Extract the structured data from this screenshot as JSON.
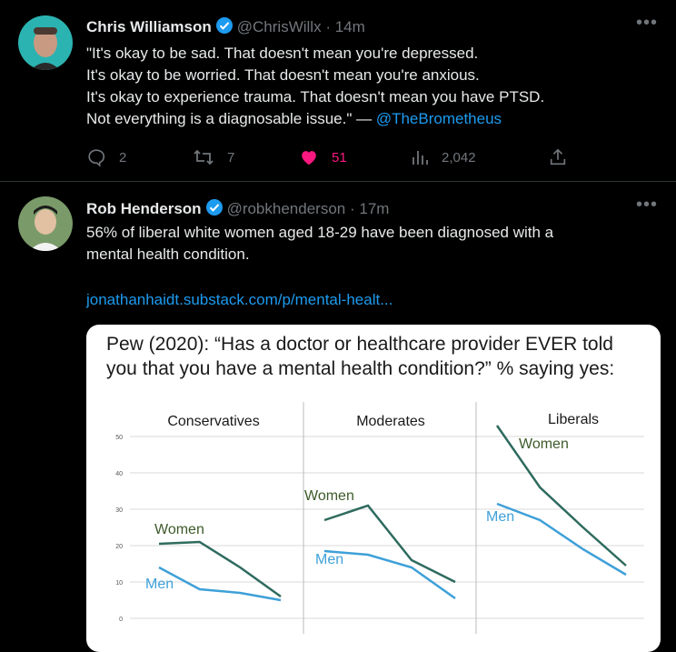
{
  "tweets": [
    {
      "name": "Chris Williamson",
      "handle": "@ChrisWillx",
      "separator": "·",
      "time": "14m",
      "lines": [
        "\"It's okay to be sad. That doesn't mean you're depressed.",
        "It's okay to be worried. That doesn't mean you're anxious.",
        "It's okay to experience trauma. That doesn't mean you have PTSD."
      ],
      "last_line_text": "Not everything is a diagnosable issue.\" — ",
      "mention": "@TheBrometheus",
      "actions": {
        "replies": "2",
        "retweets": "7",
        "likes": "51",
        "views": "2,042"
      }
    },
    {
      "name": "Rob Henderson",
      "handle": "@robkhenderson",
      "separator": "·",
      "time": "17m",
      "lines": [
        "56% of liberal white women aged 18-29 have been diagnosed with a",
        "mental health condition."
      ],
      "link": "jonathanhaidt.substack.com/p/mental-healt...",
      "card": {
        "title_lines": [
          "Pew (2020): “Has a doctor or healthcare provider EVER told",
          "you that you have a mental health condition?” % saying yes:"
        ]
      }
    }
  ],
  "chart_data": {
    "type": "line",
    "title": "Pew (2020): “Has a doctor or healthcare provider EVER told you that you have a mental health condition?” % saying yes:",
    "ylim": [
      0,
      50
    ],
    "yticks": [
      "0",
      "10",
      "20",
      "30",
      "40",
      "50"
    ],
    "panels": [
      {
        "title": "Conservatives",
        "series": [
          {
            "name": "Women",
            "values": [
              20.5,
              21,
              14,
              6
            ]
          },
          {
            "name": "Men",
            "values": [
              14,
              8,
              7,
              5
            ]
          }
        ]
      },
      {
        "title": "Moderates",
        "series": [
          {
            "name": "Women",
            "values": [
              27,
              31,
              16,
              10
            ]
          },
          {
            "name": "Men",
            "values": [
              18.5,
              17.5,
              14,
              5.5
            ]
          }
        ]
      },
      {
        "title": "Liberals",
        "series": [
          {
            "name": "Women",
            "values": [
              53,
              36,
              25,
              14.5
            ]
          },
          {
            "name": "Men",
            "values": [
              31.5,
              27,
              19,
              12
            ]
          }
        ]
      }
    ],
    "colors": {
      "Women": "#2e6b5e",
      "Men": "#3ea0d8",
      "Women_label": "#3d5a2a"
    }
  },
  "colors": {
    "verified": "#1d9bf0",
    "like": "#f91880",
    "link": "#1d9bf0"
  }
}
